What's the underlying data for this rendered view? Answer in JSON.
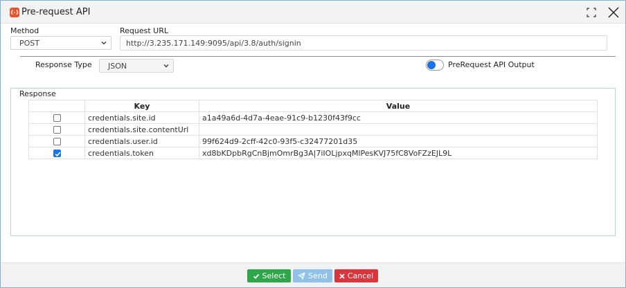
{
  "window": {
    "title": "Pre-request API",
    "icon": "api-braces-icon"
  },
  "method": {
    "label": "Method",
    "value": "POST"
  },
  "request_url": {
    "label": "Request URL",
    "value": "http://3.235.171.149:9095/api/3.8/auth/signin"
  },
  "response_type": {
    "label": "Response Type",
    "value": "JSON"
  },
  "output_toggle": {
    "label": "PreRequest API Output",
    "on": true
  },
  "response": {
    "legend": "Response",
    "columns": [
      "",
      "Key",
      "Value"
    ],
    "rows": [
      {
        "checked": false,
        "key": "credentials.site.id",
        "value": "a1a49a6d-4d7a-4eae-91c9-b1230f43f9cc"
      },
      {
        "checked": false,
        "key": "credentials.site.contentUrl",
        "value": ""
      },
      {
        "checked": false,
        "key": "credentials.user.id",
        "value": "99f624d9-2cff-42c0-93f5-c32477201d35"
      },
      {
        "checked": true,
        "key": "credentials.token",
        "value": "xd8bKDpbRgCnBjmOmrBg3A|7iIOLjpxqMlPesKVJ75fC8VoFZzEJL9L"
      }
    ]
  },
  "buttons": {
    "select": "Select",
    "send": "Send",
    "cancel": "Cancel"
  },
  "colors": {
    "select": "#2fa64a",
    "send": "#8fc1e9",
    "cancel": "#d9363e",
    "accent": "#1a73e8",
    "app_icon": "#e8542a"
  }
}
